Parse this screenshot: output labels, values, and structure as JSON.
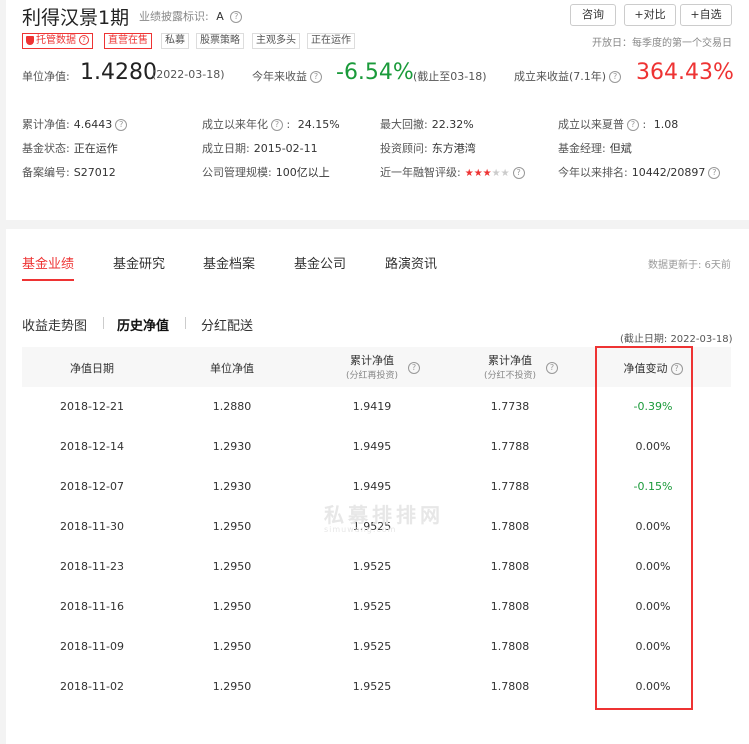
{
  "header": {
    "fund_name": "利得汉景1期",
    "disclosure_label": "业绩披露标识:",
    "disclosure_value": "A",
    "buttons": {
      "consult": "咨询",
      "compare": "+对比",
      "watch": "+自选"
    },
    "open_day_note": "开放日：每季度的第一个交易日",
    "tags": [
      "托管数据",
      "直营在售",
      "私募",
      "股票策略",
      "主观多头",
      "正在运作"
    ]
  },
  "summary": {
    "nav_label": "单位净值:",
    "nav_value": "1.4280",
    "nav_date": "(2022-03-18)",
    "ytd_label": "今年来收益",
    "ytd_value": "-6.54%",
    "ytd_note": "(截止至03-18)",
    "since_label": "成立来收益(7.1年)",
    "since_value": "364.43%"
  },
  "info": [
    [
      {
        "label": "累计净值:",
        "value": "4.6443",
        "q": true
      },
      {
        "label": "成立以来年化",
        "value": "24.15%",
        "q": true,
        "colon": true
      },
      {
        "label": "最大回撤:",
        "value": "22.32%"
      },
      {
        "label": "成立以来夏普",
        "value": "1.08",
        "q": true,
        "colon": true
      }
    ],
    [
      {
        "label": "基金状态:",
        "value": "正在运作"
      },
      {
        "label": "成立日期:",
        "value": "2015-02-11"
      },
      {
        "label": "投资顾问:",
        "value": "东方港湾",
        "link": true
      },
      {
        "label": "基金经理:",
        "value": "但斌",
        "link": true
      }
    ],
    [
      {
        "label": "备案编号:",
        "value": "S27012"
      },
      {
        "label": "公司管理规模:",
        "value": "100亿以上"
      },
      {
        "label": "近一年融智评级:",
        "stars": 3
      },
      {
        "label": "今年以来排名:",
        "value": "10442/20897",
        "q": true
      }
    ]
  ],
  "tabs": [
    "基金业绩",
    "基金研究",
    "基金档案",
    "基金公司",
    "路演资讯"
  ],
  "update_note": "数据更新于: 6天前",
  "subtabs": [
    "收益走势图",
    "历史净值",
    "分红配送"
  ],
  "deadline_note": "(截止日期: 2022-03-18)",
  "table": {
    "headers": [
      {
        "main": "净值日期"
      },
      {
        "main": "单位净值"
      },
      {
        "main": "累计净值",
        "sub": "(分红再投资)",
        "q": true
      },
      {
        "main": "累计净值",
        "sub": "(分红不投资)",
        "q": true
      },
      {
        "main": "净值变动",
        "q": true
      }
    ],
    "rows": [
      [
        "2018-12-21",
        "1.2880",
        "1.9419",
        "1.7738",
        "-0.39%"
      ],
      [
        "2018-12-14",
        "1.2930",
        "1.9495",
        "1.7788",
        "0.00%"
      ],
      [
        "2018-12-07",
        "1.2930",
        "1.9495",
        "1.7788",
        "-0.15%"
      ],
      [
        "2018-11-30",
        "1.2950",
        "1.9525",
        "1.7808",
        "0.00%"
      ],
      [
        "2018-11-23",
        "1.2950",
        "1.9525",
        "1.7808",
        "0.00%"
      ],
      [
        "2018-11-16",
        "1.2950",
        "1.9525",
        "1.7808",
        "0.00%"
      ],
      [
        "2018-11-09",
        "1.2950",
        "1.9525",
        "1.7808",
        "0.00%"
      ],
      [
        "2018-11-02",
        "1.2950",
        "1.9525",
        "1.7808",
        "0.00%"
      ]
    ]
  },
  "watermark": {
    "main": "私募排排网",
    "sub": "simuwang.com"
  },
  "colors": {
    "accent_red": "#e33333",
    "gain_green": "#1a9a3a",
    "link_blue": "#2a6fd6"
  }
}
